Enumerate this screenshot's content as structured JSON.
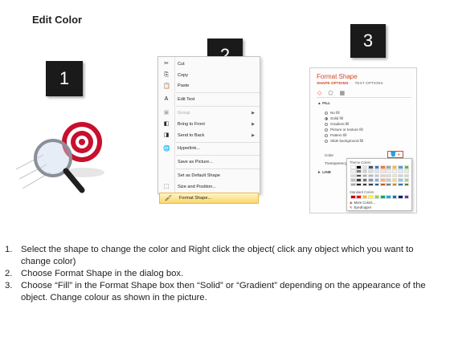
{
  "page": {
    "title": "Edit Color"
  },
  "steps": [
    {
      "number": "1"
    },
    {
      "number": "2"
    },
    {
      "number": "3"
    }
  ],
  "context_menu": {
    "items": [
      {
        "label": "Cut",
        "icon": "scissors-icon",
        "glyph": "✂",
        "disabled": false,
        "submenu": false
      },
      {
        "label": "Copy",
        "icon": "copy-icon",
        "glyph": "⎘",
        "disabled": false,
        "submenu": false
      },
      {
        "label": "Paste",
        "icon": "paste-icon",
        "glyph": "📋",
        "disabled": false,
        "submenu": false
      },
      {
        "label": "Edit Text",
        "icon": "edit-text-icon",
        "glyph": "A",
        "disabled": false,
        "submenu": false,
        "separator_before": true
      },
      {
        "label": "Group",
        "icon": "group-icon",
        "glyph": "▣",
        "disabled": true,
        "submenu": true,
        "separator_before": true
      },
      {
        "label": "Bring to Front",
        "icon": "bring-front-icon",
        "glyph": "◧",
        "disabled": false,
        "submenu": true
      },
      {
        "label": "Send to Back",
        "icon": "send-back-icon",
        "glyph": "◨",
        "disabled": false,
        "submenu": true
      },
      {
        "label": "Hyperlink...",
        "icon": "hyperlink-icon",
        "glyph": "🌐",
        "disabled": false,
        "submenu": false,
        "separator_before": true
      },
      {
        "label": "Save as Picture...",
        "icon": "",
        "glyph": "",
        "disabled": false,
        "submenu": false,
        "separator_before": true
      },
      {
        "label": "Set as Default Shape",
        "icon": "",
        "glyph": "",
        "disabled": false,
        "submenu": false,
        "separator_before": true
      },
      {
        "label": "Size and Position...",
        "icon": "size-position-icon",
        "glyph": "⬚",
        "disabled": false,
        "submenu": false
      },
      {
        "label": "Format Shape...",
        "icon": "format-shape-icon",
        "glyph": "🖌",
        "disabled": false,
        "submenu": false,
        "highlighted": true
      }
    ]
  },
  "format_panel": {
    "title": "Format Shape",
    "tabs": [
      "SHAPE OPTIONS",
      "TEXT OPTIONS"
    ],
    "fill_section": "FILL",
    "fill_options": [
      {
        "label": "No fill",
        "checked": false
      },
      {
        "label": "Solid fill",
        "checked": true
      },
      {
        "label": "Gradient fill",
        "checked": false
      },
      {
        "label": "Picture or texture fill",
        "checked": false
      },
      {
        "label": "Pattern fill",
        "checked": false
      },
      {
        "label": "Slide background fill",
        "checked": false
      }
    ],
    "color_label": "Color",
    "transparency_label": "Transparency",
    "line_section": "LINE",
    "palette": {
      "theme_label": "Theme Colors",
      "standard_label": "Standard Colors",
      "more_colors": "More Colors...",
      "eyedropper": "Eyedropper",
      "theme_colors": [
        "#ffffff",
        "#000000",
        "#e7e6e6",
        "#44546a",
        "#4472c4",
        "#ed7d31",
        "#a5a5a5",
        "#ffc000",
        "#5b9bd5",
        "#70ad47",
        "#f2f2f2",
        "#7f7f7f",
        "#d0cece",
        "#d6dce4",
        "#d9e2f3",
        "#fbe5d5",
        "#ededed",
        "#fff2cc",
        "#deebf6",
        "#e2efd9",
        "#d8d8d8",
        "#595959",
        "#aeabab",
        "#adb9ca",
        "#b4c6e7",
        "#f7cbac",
        "#dbdbdb",
        "#fee599",
        "#bdd7ee",
        "#c5e0b3",
        "#bfbfbf",
        "#3f3f3f",
        "#757070",
        "#8496b0",
        "#8eaadb",
        "#f4b183",
        "#c9c9c9",
        "#ffd965",
        "#9cc3e5",
        "#a8d08d",
        "#a5a5a5",
        "#262626",
        "#3a3838",
        "#323f4f",
        "#2f5496",
        "#c55a11",
        "#7b7b7b",
        "#bf9000",
        "#2e75b5",
        "#538135"
      ],
      "standard_colors": [
        "#c00000",
        "#ff0000",
        "#ffc000",
        "#ffff00",
        "#92d050",
        "#00b050",
        "#00b0f0",
        "#0070c0",
        "#002060",
        "#7030a0"
      ]
    }
  },
  "instructions": [
    {
      "num": "1.",
      "text": "Select the shape to change the color and Right click the object( click any object which you want to change color)"
    },
    {
      "num": "2.",
      "text": "Choose Format Shape in the dialog box."
    },
    {
      "num": "3.",
      "text": "Choose “Fill” in the Format Shape box then “Solid” or “Gradient” depending on the appearance of the object. Change colour as shown in the picture."
    }
  ],
  "colors": {
    "accent": "#d24726",
    "badge": "#1a1a1a",
    "target_red": "#c8102e"
  }
}
